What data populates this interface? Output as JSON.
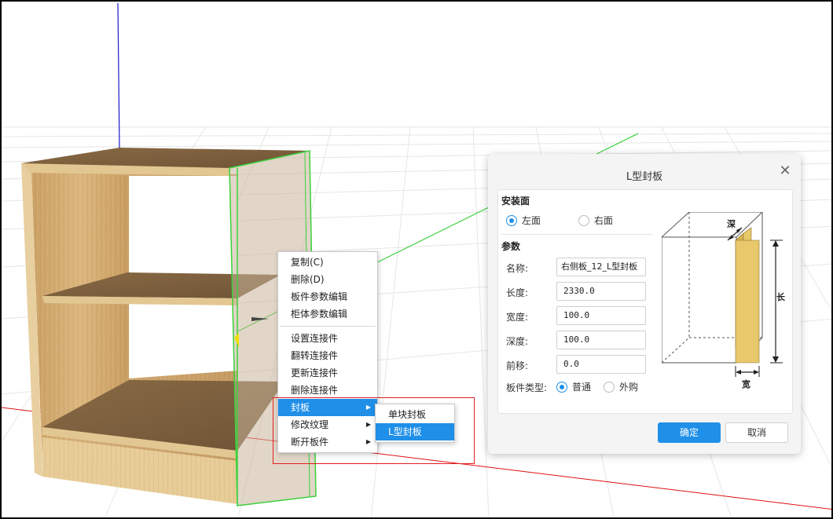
{
  "context_menu": {
    "items": [
      {
        "label": "复制(C)"
      },
      {
        "label": "删除(D)"
      },
      {
        "label": "板件参数编辑"
      },
      {
        "label": "柜体参数编辑"
      },
      {
        "label": "设置连接件"
      },
      {
        "label": "翻转连接件"
      },
      {
        "label": "更新连接件"
      },
      {
        "label": "删除连接件"
      },
      {
        "label": "封板",
        "has_submenu": true,
        "active": true
      },
      {
        "label": "修改纹理",
        "has_submenu": true
      },
      {
        "label": "断开板件",
        "has_submenu": true
      }
    ],
    "submenu": {
      "items": [
        {
          "label": "单块封板"
        },
        {
          "label": "L型封板",
          "active": true
        }
      ]
    }
  },
  "dialog": {
    "title": "L型封板",
    "install_face": {
      "title": "安装面",
      "left": "左面",
      "right": "右面",
      "selected": "左面"
    },
    "params": {
      "title": "参数",
      "name_label": "名称:",
      "name_value": "右侧板_12_L型封板",
      "length_label": "长度:",
      "length_value": "2330.0",
      "width_label": "宽度:",
      "width_value": "100.0",
      "depth_label": "深度:",
      "depth_value": "100.0",
      "offset_label": "前移:",
      "offset_value": "0.0",
      "type_label": "板件类型:",
      "type_normal": "普通",
      "type_outsource": "外购",
      "type_selected": "普通"
    },
    "diagram": {
      "depth_label": "深",
      "length_label": "长",
      "width_label": "宽"
    },
    "ok_label": "确定",
    "cancel_label": "取消"
  },
  "colors": {
    "accent": "#1f8fe8",
    "highlight_box": "#e02020",
    "selection": "#3cd23c",
    "wood_light": "#e8c98f",
    "wood_dark": "#7a5f3e",
    "panel_yellow": "#e8c86a"
  }
}
